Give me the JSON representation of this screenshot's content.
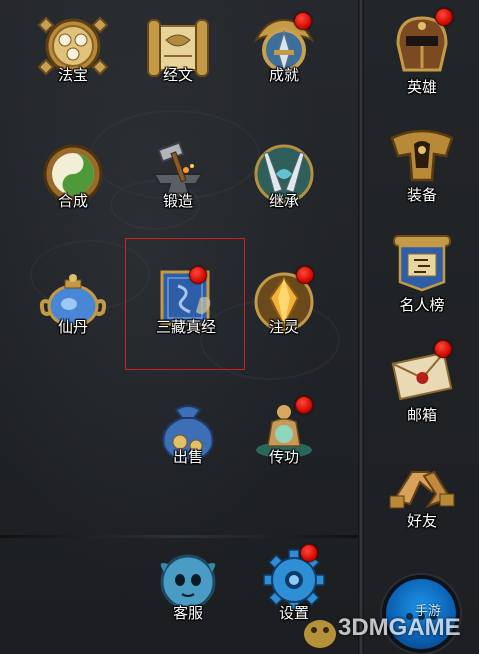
{
  "main_grid": [
    {
      "id": "fabao",
      "label": "法宝",
      "icon": "treasure-disc-icon",
      "badge": false
    },
    {
      "id": "jingwen",
      "label": "经文",
      "icon": "scroll-icon",
      "badge": false
    },
    {
      "id": "chengjiu",
      "label": "成就",
      "icon": "achievement-sword-icon",
      "badge": true
    },
    {
      "id": "hecheng",
      "label": "合成",
      "icon": "yin-yang-icon",
      "badge": false
    },
    {
      "id": "duanzao",
      "label": "锻造",
      "icon": "anvil-hammer-icon",
      "badge": false
    },
    {
      "id": "jicheng",
      "label": "继承",
      "icon": "crossed-swords-icon",
      "badge": false
    },
    {
      "id": "xiandan",
      "label": "仙丹",
      "icon": "elixir-pot-icon",
      "badge": false
    },
    {
      "id": "sanzang",
      "label": "三藏真经",
      "icon": "sutra-book-icon",
      "badge": true
    },
    {
      "id": "zhuling",
      "label": "注灵",
      "icon": "spirit-crystal-icon",
      "badge": true
    },
    {
      "id": "chushou",
      "label": "出售",
      "icon": "money-bag-icon",
      "badge": false
    },
    {
      "id": "chuangong",
      "label": "传功",
      "icon": "meditating-monk-icon",
      "badge": true
    }
  ],
  "bottom_bar": [
    {
      "id": "kefu",
      "label": "客服",
      "icon": "support-avatar-icon",
      "badge": false
    },
    {
      "id": "shezhi",
      "label": "设置",
      "icon": "gear-icon",
      "badge": true
    }
  ],
  "side_menu": [
    {
      "id": "yingxiong",
      "label": "英雄",
      "icon": "hero-helmet-icon",
      "badge": true
    },
    {
      "id": "zhuangbei",
      "label": "装备",
      "icon": "armor-icon",
      "badge": false
    },
    {
      "id": "mingrenbang",
      "label": "名人榜",
      "icon": "ranking-banner-icon",
      "badge": false
    },
    {
      "id": "youxiang",
      "label": "邮箱",
      "icon": "envelope-icon",
      "badge": true
    },
    {
      "id": "haoyou",
      "label": "好友",
      "icon": "handshake-icon",
      "badge": false
    }
  ],
  "chat_button": {
    "icon": "chat-bubble-icon"
  },
  "watermark": {
    "text": "3DMGAME",
    "text_cn": "手游"
  },
  "colors": {
    "badge": "#e0150a",
    "highlight": "#c9241c",
    "label": "#ffffff",
    "chat": "#1680d6"
  }
}
